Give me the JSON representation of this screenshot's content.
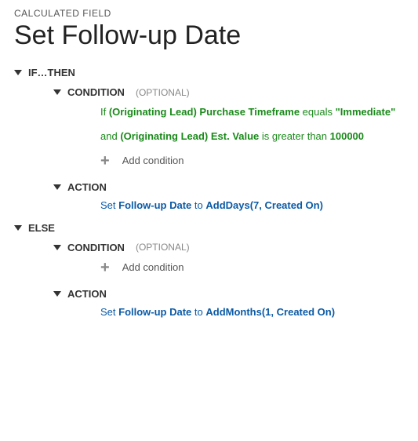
{
  "eyebrow": "CALCULATED FIELD",
  "title": "Set Follow-up Date",
  "ifthen": {
    "label": "IF…THEN",
    "condition": {
      "label": "CONDITION",
      "optional": "(OPTIONAL)",
      "line1": {
        "prefix": "If ",
        "field": "(Originating Lead) Purchase Timeframe",
        "op": " equals ",
        "value": "\"Immediate\""
      },
      "line2": {
        "prefix": "and ",
        "field": "(Originating Lead) Est. Value",
        "op": " is greater than ",
        "value": "100000"
      },
      "add": "Add condition"
    },
    "action": {
      "label": "ACTION",
      "set": "Set ",
      "field": "Follow-up Date",
      "to": " to ",
      "func": "AddDays(7, Created On)"
    }
  },
  "else": {
    "label": "ELSE",
    "condition": {
      "label": "CONDITION",
      "optional": "(OPTIONAL)",
      "add": "Add condition"
    },
    "action": {
      "label": "ACTION",
      "set": "Set ",
      "field": "Follow-up Date",
      "to": " to ",
      "func": "AddMonths(1, Created On)"
    }
  }
}
